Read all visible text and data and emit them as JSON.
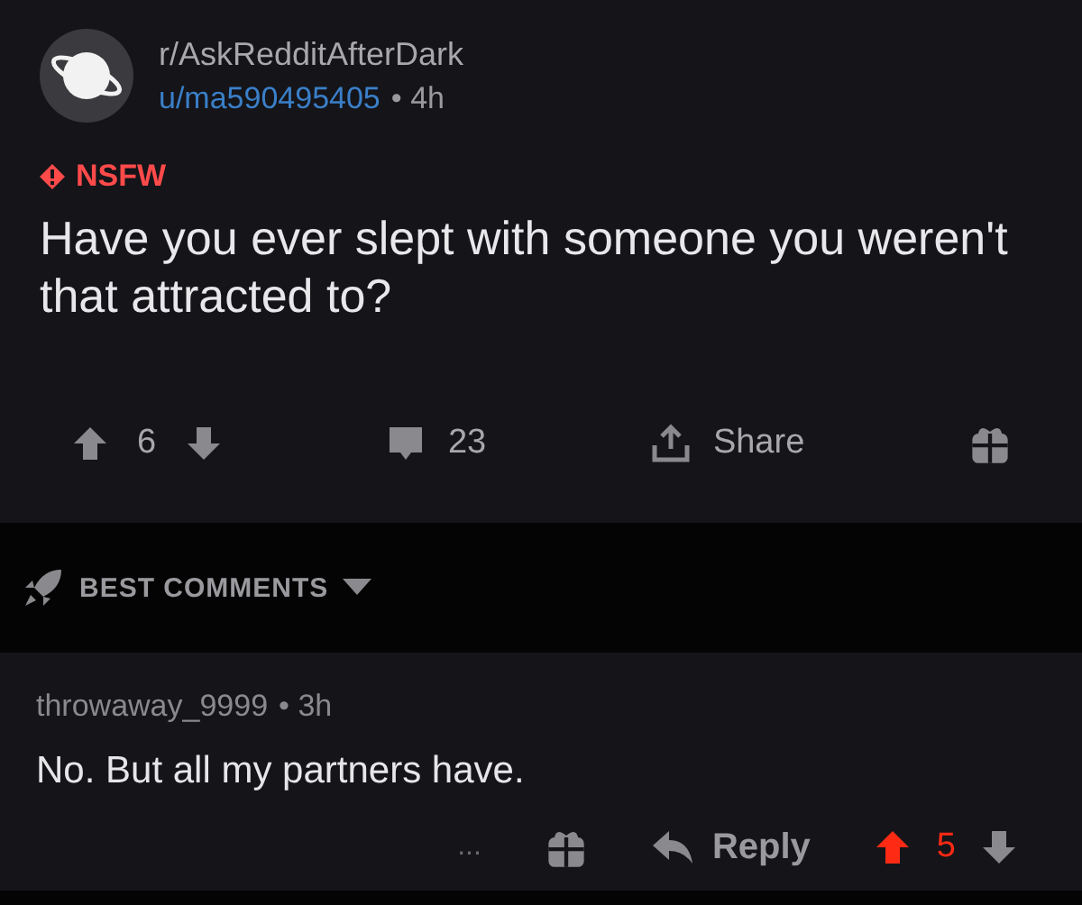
{
  "post": {
    "subreddit": "r/AskRedditAfterDark",
    "author": "u/ma590495405",
    "time": "• 4h",
    "badge": "NSFW",
    "title": "Have you ever slept with someone you weren't that attracted to?",
    "votes": {
      "score": "6",
      "upvoted": false,
      "downvoted": false
    },
    "comments": "23",
    "share": "Share"
  },
  "sort": {
    "label": "BEST COMMENTS"
  },
  "comments": [
    {
      "author": "throwaway_9999",
      "time": "• 3h",
      "text": "No. But all my partners have.",
      "reply": "Reply",
      "more": "...",
      "votes": {
        "score": "5",
        "upvoted": true,
        "downvoted": false
      }
    }
  ]
}
